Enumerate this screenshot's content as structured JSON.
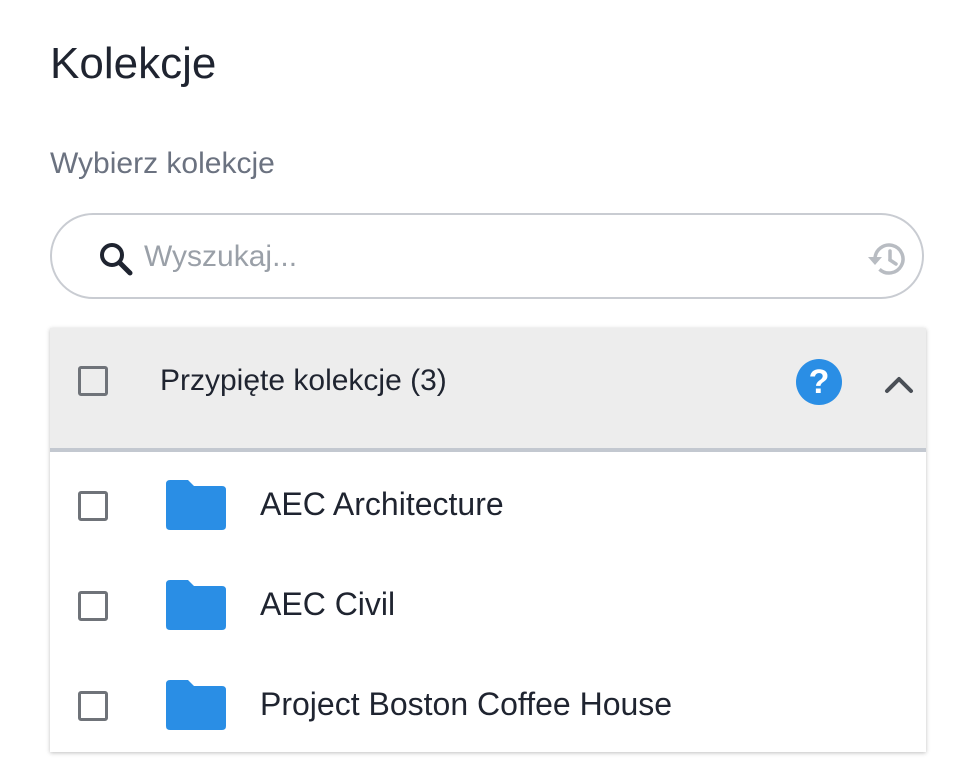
{
  "page": {
    "title": "Kolekcje",
    "subtitle": "Wybierz kolekcje"
  },
  "search": {
    "placeholder": "Wyszukaj...",
    "value": "",
    "icon": "search-icon",
    "history_icon": "history-icon"
  },
  "pinned": {
    "label": "Przypięte kolekcje (3)",
    "help_icon": "?",
    "expanded": true,
    "checked": false,
    "items": [
      {
        "label": "AEC Architecture",
        "checked": false,
        "icon": "folder-icon"
      },
      {
        "label": "AEC Civil",
        "checked": false,
        "icon": "folder-icon"
      },
      {
        "label": "Project Boston Coffee House",
        "checked": false,
        "icon": "folder-icon"
      }
    ]
  },
  "colors": {
    "accent": "#2a8ee5",
    "folder": "#2a8ee5",
    "header_bg": "#ededed",
    "text": "#1f2430",
    "muted": "#6b7280"
  }
}
